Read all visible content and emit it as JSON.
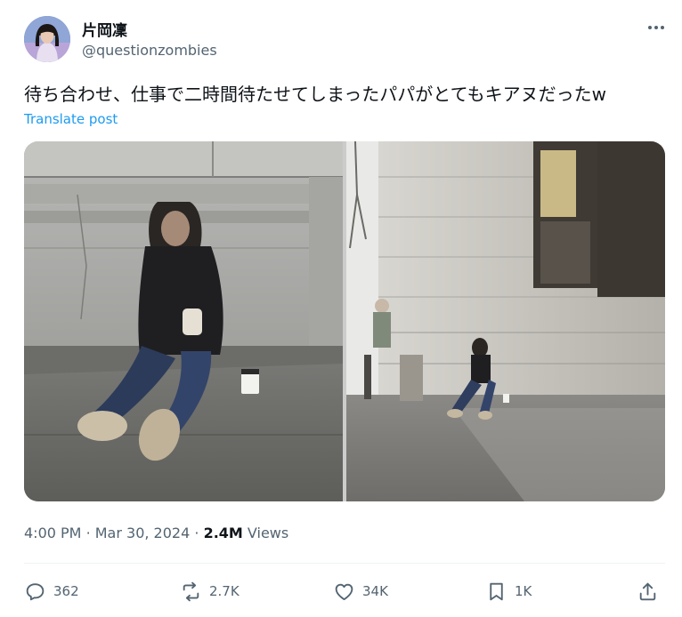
{
  "author": {
    "display_name": "片岡凜",
    "handle": "@questionzombies"
  },
  "post": {
    "text": "待ち合わせ、仕事で二時間待たせてしまったパパがとてもキアヌだったw",
    "translate_label": "Translate post",
    "time": "4:00 PM",
    "date": "Mar 30, 2024",
    "separator": "·",
    "views_count": "2.4M",
    "views_label": "Views"
  },
  "actions": {
    "replies": "362",
    "reposts": "2.7K",
    "likes": "34K",
    "bookmarks": "1K"
  },
  "colors": {
    "link": "#1d9bf0",
    "secondary_text": "#536471",
    "primary_text": "#0f1419"
  },
  "icons": [
    "more-icon",
    "reply-icon",
    "repost-icon",
    "like-icon",
    "bookmark-icon",
    "share-icon"
  ]
}
